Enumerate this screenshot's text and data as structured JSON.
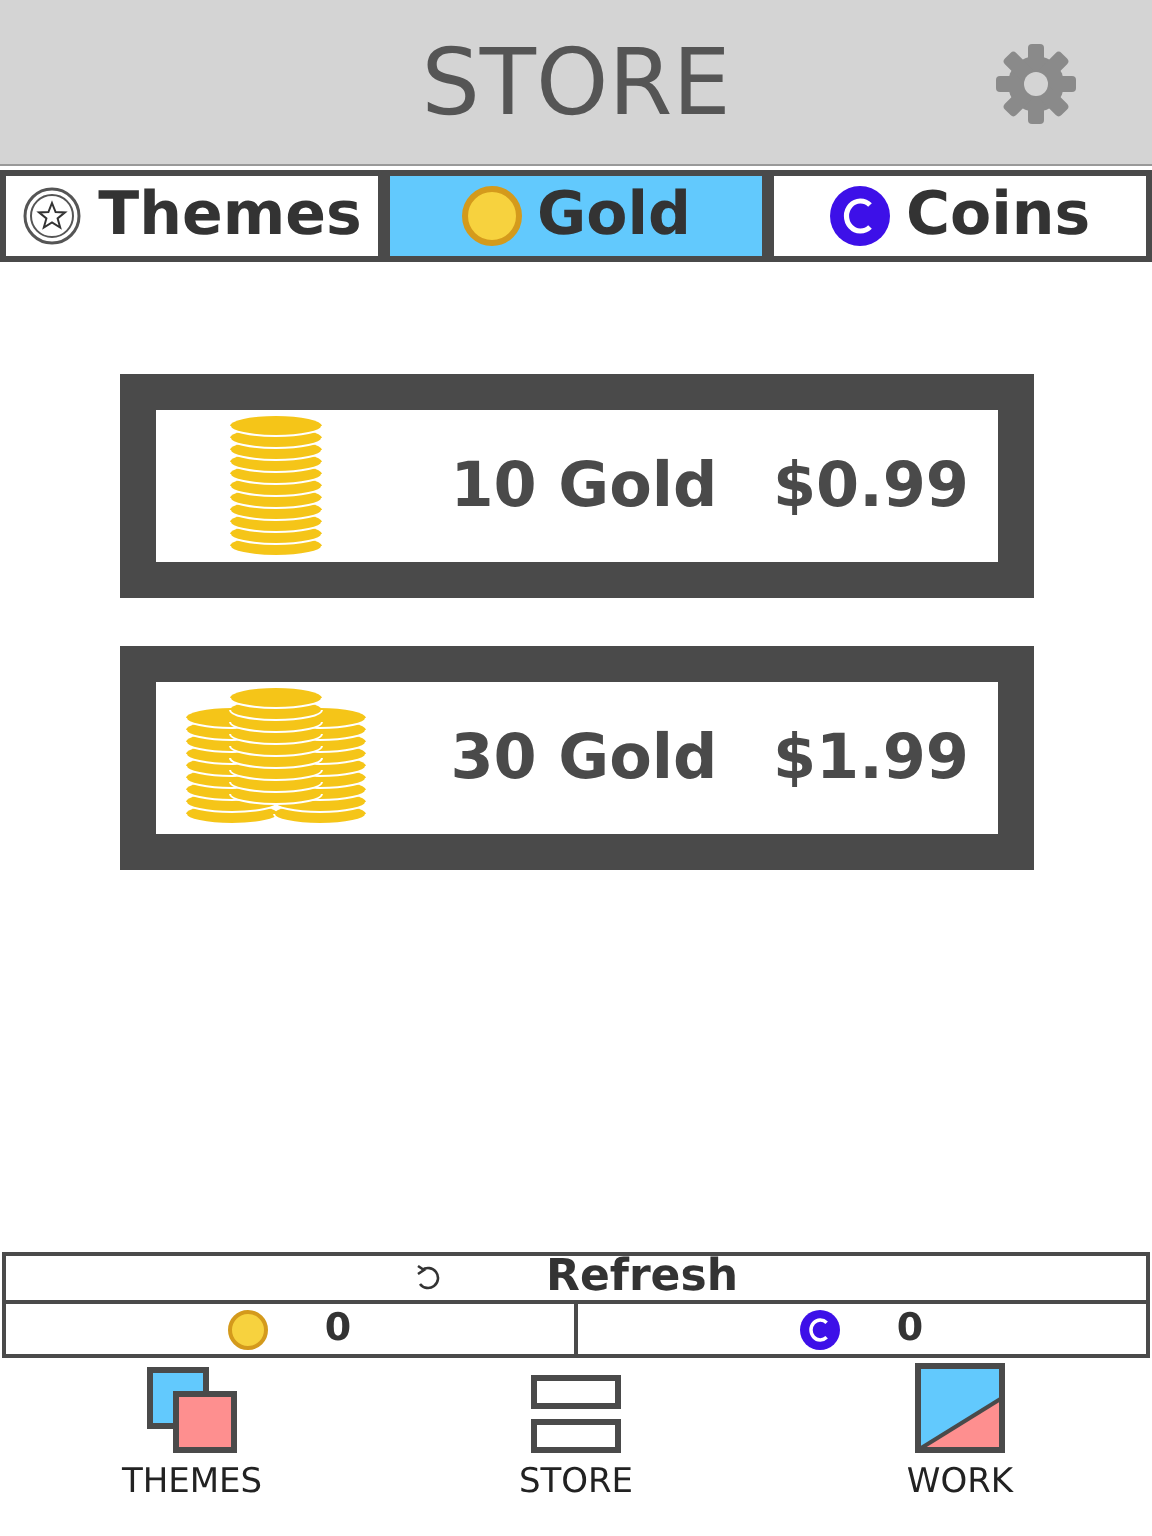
{
  "header": {
    "title": "STORE"
  },
  "tabs": [
    {
      "label": "Themes",
      "kind": "star",
      "selected": false
    },
    {
      "label": "Gold",
      "kind": "gold",
      "selected": true
    },
    {
      "label": "Coins",
      "kind": "coin",
      "selected": false
    }
  ],
  "offers": [
    {
      "kind": "stack",
      "amount": "10 Gold",
      "price": "$0.99"
    },
    {
      "kind": "pile",
      "amount": "30 Gold",
      "price": "$1.99"
    }
  ],
  "refresh": {
    "label": "Refresh"
  },
  "balances": [
    {
      "kind": "gold",
      "value": "0"
    },
    {
      "kind": "coin",
      "value": "0"
    }
  ],
  "nav": [
    {
      "kind": "themes",
      "label": "THEMES"
    },
    {
      "kind": "store",
      "label": "STORE"
    },
    {
      "kind": "work",
      "label": "WORK"
    }
  ]
}
